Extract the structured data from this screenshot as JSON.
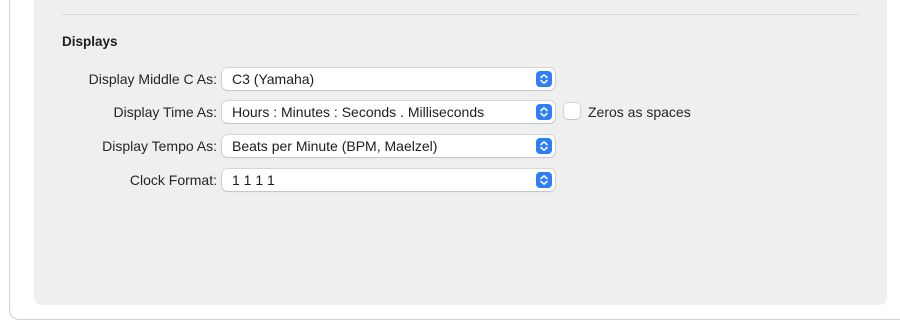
{
  "section": {
    "title": "Displays"
  },
  "rows": [
    {
      "label": "Display Middle C As:",
      "value": "C3 (Yamaha)"
    },
    {
      "label": "Display Time As:",
      "value": "Hours : Minutes : Seconds . Milliseconds"
    },
    {
      "label": "Display Tempo As:",
      "value": "Beats per Minute (BPM, Maelzel)"
    },
    {
      "label": "Clock Format:",
      "value": "1 1 1 1"
    }
  ],
  "zeros_option": {
    "label": "Zeros as spaces",
    "checked": false
  },
  "icons": {
    "popup_arrows": "chevron-up-down-icon"
  },
  "colors": {
    "accent": "#2f7ef6",
    "panel": "#efefef"
  }
}
